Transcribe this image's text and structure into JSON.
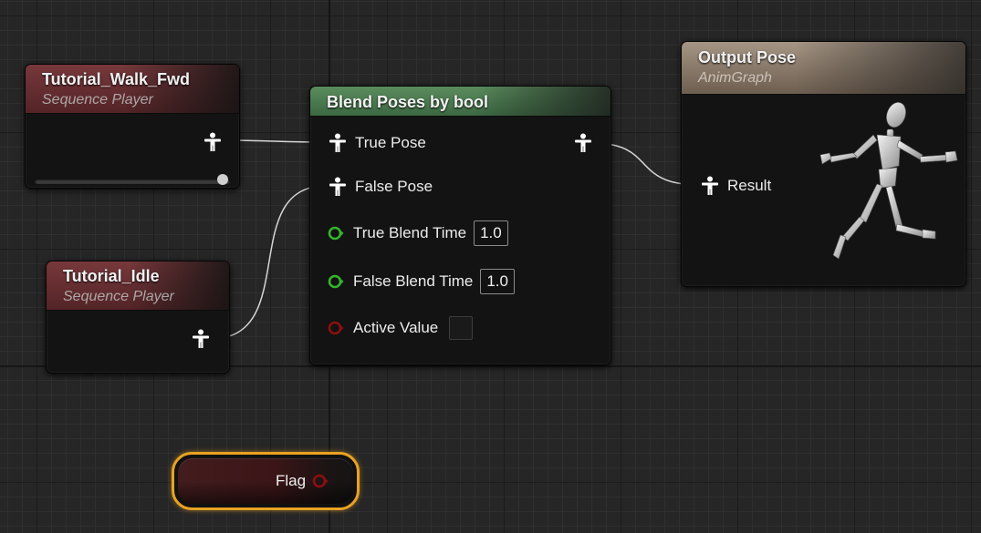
{
  "nodes": {
    "walk": {
      "title": "Tutorial_Walk_Fwd",
      "subtitle": "Sequence Player",
      "output_pin_icon": "pose-icon",
      "play_rate_slider": 1.0
    },
    "idle": {
      "title": "Tutorial_Idle",
      "subtitle": "Sequence Player",
      "output_pin_icon": "pose-icon"
    },
    "blend": {
      "title": "Blend Poses by bool",
      "pins": {
        "true_pose": "True Pose",
        "false_pose": "False Pose",
        "true_blend_time": "True Blend Time",
        "true_blend_time_value": "1.0",
        "false_blend_time": "False Blend Time",
        "false_blend_time_value": "1.0",
        "active_value": "Active Value",
        "active_value_checked": false
      }
    },
    "output": {
      "title": "Output Pose",
      "subtitle": "AnimGraph",
      "result_label": "Result",
      "preview_icon": "mannequin-running-icon"
    },
    "flag": {
      "label": "Flag",
      "pin_icon": "bool-pin-icon"
    }
  },
  "colors": {
    "sequence_player_header": "#77383b",
    "blend_header": "#5a8c5d",
    "output_header": "#a59584",
    "float_pin": "#35b52b",
    "bool_pin": "#8c0f0f",
    "flag_selection": "#e9a222",
    "grid_background": "#262626"
  }
}
